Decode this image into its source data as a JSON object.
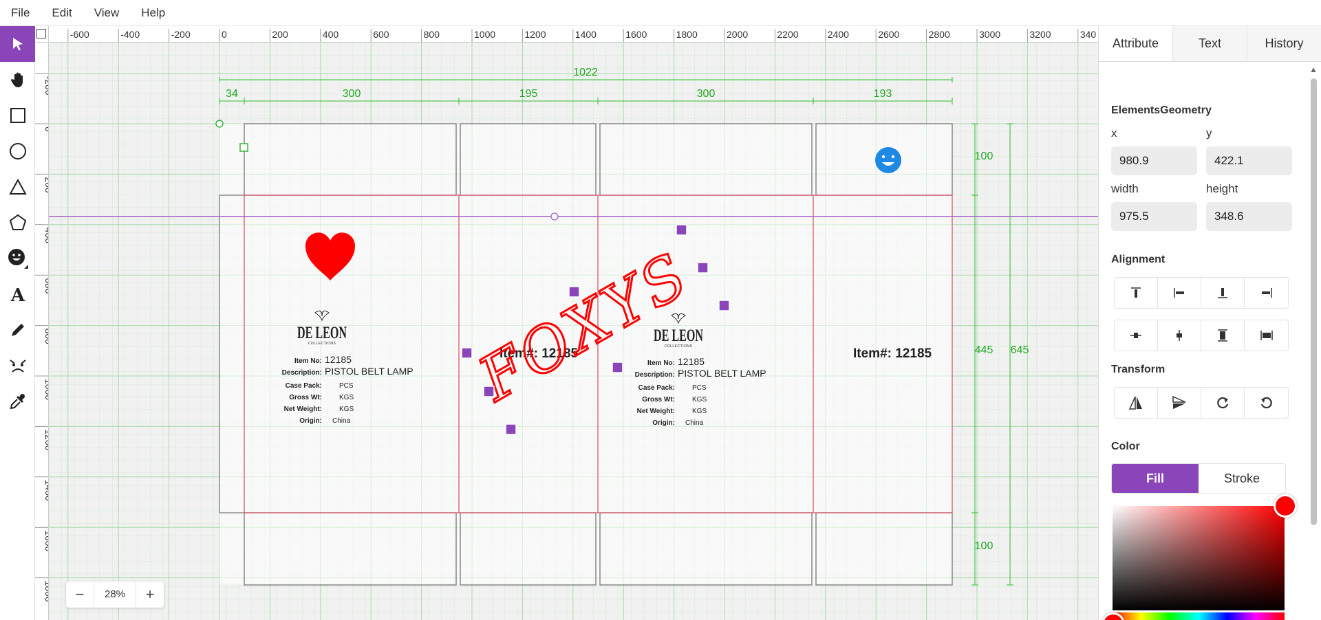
{
  "menu": [
    "File",
    "Edit",
    "View",
    "Help"
  ],
  "toolbar": {
    "tools": [
      {
        "name": "select-tool",
        "icon": "arrow-pointer",
        "active": true
      },
      {
        "name": "pan-tool",
        "icon": "hand"
      },
      {
        "name": "rectangle-tool",
        "icon": "square"
      },
      {
        "name": "ellipse-tool",
        "icon": "circle"
      },
      {
        "name": "triangle-tool",
        "icon": "triangle"
      },
      {
        "name": "polygon-tool",
        "icon": "pentagon"
      },
      {
        "name": "emoji-tool",
        "icon": "smiley"
      },
      {
        "name": "text-tool",
        "icon": "letter-a"
      },
      {
        "name": "line-tool",
        "icon": "pencil"
      },
      {
        "name": "face-tool",
        "icon": "face"
      },
      {
        "name": "eyedropper-tool",
        "icon": "eyedropper"
      }
    ]
  },
  "ruler": {
    "top_labels": [
      "-600",
      "-400",
      "-200",
      "0",
      "200",
      "400",
      "600",
      "800",
      "1000",
      "1200",
      "1400",
      "1600",
      "1800",
      "2000",
      "2200",
      "2400",
      "2600",
      "2800",
      "3000",
      "3200",
      "340"
    ],
    "left_labels": [
      "-200",
      "0",
      "200",
      "400",
      "600",
      "800",
      "1000",
      "1200",
      "1400",
      "1600",
      "1800"
    ]
  },
  "dimensions": {
    "total_width": "1022",
    "top_segments": [
      "34",
      "300",
      "195",
      "300",
      "193"
    ],
    "right_heights": [
      "100",
      "445",
      "100"
    ],
    "total_height": "645"
  },
  "artwork": {
    "logo_text": "DE LEON",
    "logo_sub": "COLLECTIONS",
    "item_label": "Item#: 12185",
    "foxys_text": "FOXYS",
    "spec_rows": [
      {
        "label": "Item No:",
        "value": "12185"
      },
      {
        "label": "Description:",
        "value": "PISTOL BELT LAMP"
      },
      {
        "label": "Case Pack:",
        "value": "PCS"
      },
      {
        "label": "Gross Wt:",
        "value": "KGS"
      },
      {
        "label": "Net Weight:",
        "value": "KGS"
      },
      {
        "label": "Origin:",
        "value": "China"
      }
    ]
  },
  "zoom": {
    "minus": "−",
    "value": "28%",
    "plus": "+"
  },
  "panel": {
    "tabs": [
      "Attribute",
      "Text",
      "History"
    ],
    "geometry_title": "ElementsGeometry",
    "x_label": "x",
    "x_value": "980.9",
    "y_label": "y",
    "y_value": "422.1",
    "width_label": "width",
    "width_value": "975.5",
    "height_label": "height",
    "height_value": "348.6",
    "alignment_title": "Alignment",
    "transform_title": "Transform",
    "color_title": "Color",
    "fill_label": "Fill",
    "stroke_label": "Stroke"
  },
  "colors": {
    "accent": "#8a45b9",
    "dimension_green": "#1fa81f",
    "dieline_red": "#d45a6a",
    "foxys_red": "#ff0000",
    "heart_red": "#ff0000",
    "emoji_blue": "#1e88e5",
    "fill_color": "#ff0000"
  }
}
